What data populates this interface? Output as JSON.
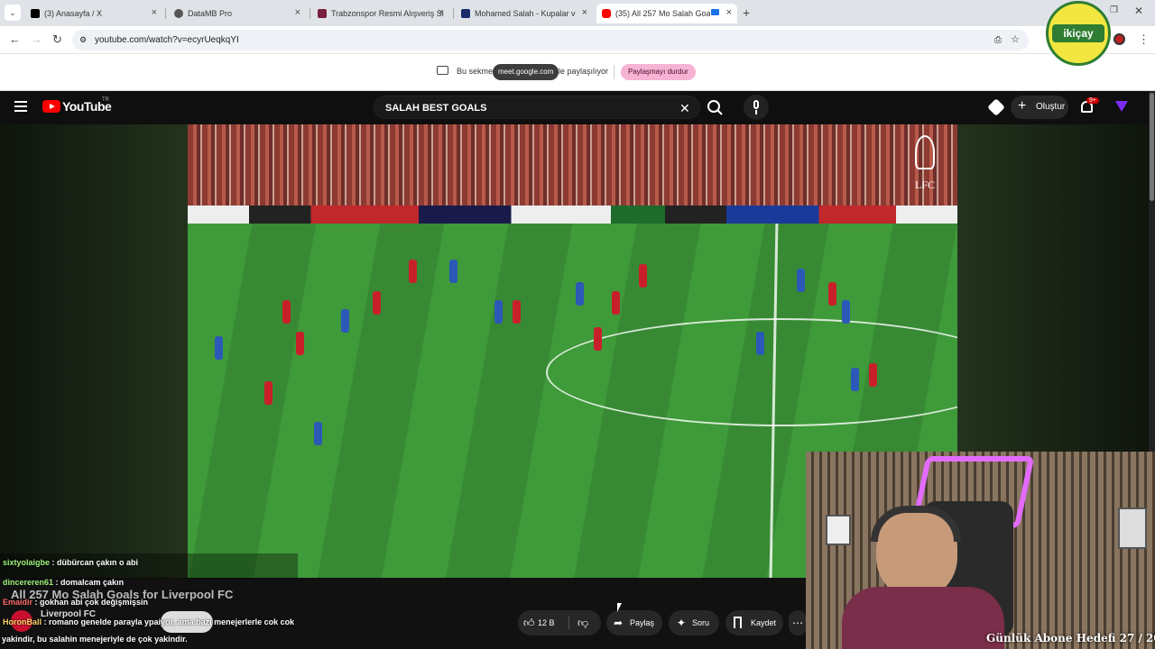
{
  "browser": {
    "tabs": [
      {
        "label": "(3) Anasayfa / X",
        "icon_color": "#000000"
      },
      {
        "label": "DataMB Pro",
        "icon_color": "#444444"
      },
      {
        "label": "Trabzonspor Resmi Alışveriş Sitesi",
        "icon_color": "#7a1f3d"
      },
      {
        "label": "Mohamed Salah - Kupalar ve b",
        "icon_color": "#1b2a6b"
      },
      {
        "label": "(35) All 257 Mo Salah Goals",
        "icon_color": "#ff0000"
      }
    ],
    "url": "youtube.com/watch?v=ecyrUeqkqYI",
    "profile_logo_text": "ikiçay"
  },
  "share_bar": {
    "prefix": "Bu sekme",
    "domain": "meet.google.com",
    "suffix": "ile paylaşılıyor",
    "stop_label": "Paylaşmayı durdur"
  },
  "youtube": {
    "logo": "YouTube",
    "region": "TR",
    "search_value": "SALAH BEST GOALS",
    "create_label": "Oluştur",
    "notif_count": "9+",
    "video_title": "All 257 Mo Salah Goals for Liverpool FC",
    "channel": "Liverpool FC",
    "like_count": "12 B",
    "share_label": "Paylaş",
    "ask_label": "Soru",
    "save_label": "Kaydet",
    "club_badge": "LFC"
  },
  "chat": [
    {
      "user": "sixtyolaigbe",
      "msg": "dübürcan çakın o abi",
      "color": "#9ff57a"
    },
    {
      "user": "dincereren61",
      "msg": "domalcam çakın",
      "color": "#9ff57a"
    },
    {
      "user": "Emaidir",
      "msg": "gokhan abi çok değişmişsin",
      "color": "#ff6b6b"
    },
    {
      "user": "HoronBall",
      "msg": "romano genelde parayla ypaiyor, ama bazı menejerlerle cok cok",
      "color": "#ffd36b"
    },
    {
      "user": "",
      "msg": "yakindir, bu salahin menejeriyle de çok yakindir.",
      "color": "#ffffff"
    }
  ],
  "overlay": {
    "subscriber_goal": "Günlük Abone Hedefi 27 / 20"
  },
  "colors": {
    "youtube_red": "#ff0000",
    "share_pill": "#f7b3d3",
    "tab_bg": "#dfe3e8"
  }
}
